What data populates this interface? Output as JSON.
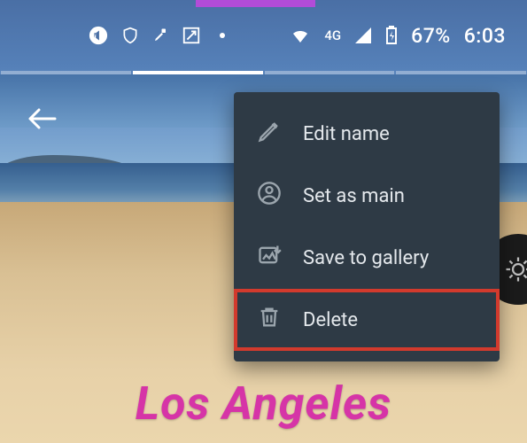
{
  "statusbar": {
    "network_label": "4G",
    "battery_percent": "67%",
    "time": "6:03"
  },
  "tabs": {
    "active_index": 1,
    "count": 4
  },
  "menu": {
    "items": [
      {
        "icon": "pencil-icon",
        "label": "Edit name"
      },
      {
        "icon": "person-circle-icon",
        "label": "Set as main"
      },
      {
        "icon": "save-image-icon",
        "label": "Save to gallery"
      },
      {
        "icon": "trash-icon",
        "label": "Delete",
        "highlighted": true
      }
    ]
  },
  "caption": "Los Angeles",
  "colors": {
    "popup_bg": "#2e3a45",
    "highlight": "#d23a2d",
    "caption": "#d634a7",
    "accent": "#b24cd8"
  }
}
